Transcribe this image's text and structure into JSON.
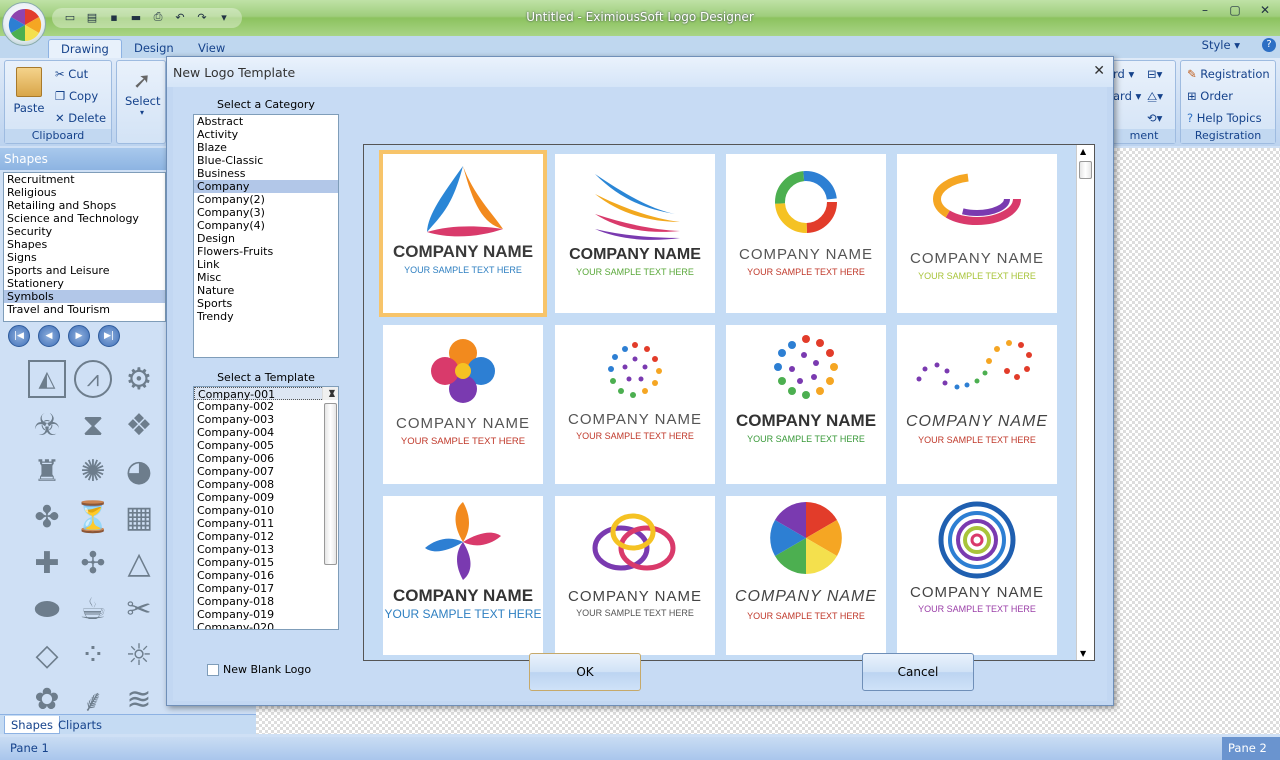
{
  "app": {
    "title": "Untitled - EximiousSoft Logo Designer",
    "tabs": [
      "Drawing",
      "Design",
      "View"
    ],
    "style_menu": "Style"
  },
  "ribbon": {
    "clipboard": {
      "label": "Clipboard",
      "paste": "Paste",
      "cut": "Cut",
      "copy": "Copy",
      "delete": "Delete"
    },
    "select": "Select",
    "partial": {
      "rd": "rd",
      "ard": "ard",
      "ment": "ment"
    },
    "registration": {
      "label": "Registration",
      "registration": "Registration",
      "order": "Order",
      "help": "Help Topics"
    }
  },
  "shapes_panel": {
    "header": "Shapes",
    "categories": [
      "Recruitment",
      "Religious",
      "Retailing and Shops",
      "Science and Technology",
      "Security",
      "Shapes",
      "Signs",
      "Sports and Leisure",
      "Stationery",
      "Symbols",
      "Travel and Tourism"
    ],
    "selected": "Symbols",
    "bottom_tabs": [
      "Shapes",
      "Cliparts"
    ]
  },
  "status": {
    "pane1": "Pane 1",
    "pane2": "Pane 2"
  },
  "dialog": {
    "title": "New Logo Template",
    "category_label": "Select a Category",
    "categories": [
      "Abstract",
      "Activity",
      "Blaze",
      "Blue-Classic",
      "Business",
      "Company",
      "Company(2)",
      "Company(3)",
      "Company(4)",
      "Design",
      "Flowers-Fruits",
      "Link",
      "Misc",
      "Nature",
      "Sports",
      "Trendy"
    ],
    "selected_category": "Company",
    "template_label": "Select a Template",
    "templates": [
      "Company-001",
      "Company-002",
      "Company-003",
      "Company-004",
      "Company-005",
      "Company-006",
      "Company-007",
      "Company-008",
      "Company-009",
      "Company-010",
      "Company-011",
      "Company-012",
      "Company-013",
      "Company-015",
      "Company-016",
      "Company-017",
      "Company-018",
      "Company-019",
      "Company-020"
    ],
    "selected_template": "Company-001",
    "blank_logo": "New Blank Logo",
    "ok": "OK",
    "cancel": "Cancel",
    "logos": [
      {
        "name": "COMPANY NAME",
        "tagline": "YOUR SAMPLE TEXT HERE",
        "tag_color": "#2e7fc1"
      },
      {
        "name": "COMPANY NAME",
        "tagline": "YOUR SAMPLE TEXT HERE",
        "tag_color": "#5aa83a"
      },
      {
        "name": "COMPANY NAME",
        "tagline": "YOUR SAMPLE TEXT HERE",
        "tag_color": "#c0392b"
      },
      {
        "name": "COMPANY NAME",
        "tagline": "YOUR SAMPLE TEXT HERE",
        "tag_color": "#a8c43a"
      },
      {
        "name": "COMPANY NAME",
        "tagline": "YOUR SAMPLE TEXT HERE",
        "tag_color": "#c0392b"
      },
      {
        "name": "COMPANY NAME",
        "tagline": "YOUR SAMPLE TEXT HERE",
        "tag_color": "#c0392b"
      },
      {
        "name": "COMPANY NAME",
        "tagline": "YOUR SAMPLE TEXT HERE",
        "tag_color": "#3a9a3a"
      },
      {
        "name": "COMPANY NAME",
        "tagline": "YOUR SAMPLE TEXT HERE",
        "tag_color": "#c0392b"
      },
      {
        "name": "COMPANY NAME",
        "tagline": "YOUR SAMPLE TEXT HERE",
        "tag_color": "#2e7fc1"
      },
      {
        "name": "COMPANY NAME",
        "tagline": "YOUR SAMPLE TEXT HERE",
        "tag_color": "#555555"
      },
      {
        "name": "COMPANY NAME",
        "tagline": "YOUR SAMPLE TEXT HERE",
        "tag_color": "#c0392b"
      },
      {
        "name": "COMPANY NAME",
        "tagline": "YOUR SAMPLE TEXT HERE",
        "tag_color": "#9b3fa8"
      }
    ]
  }
}
